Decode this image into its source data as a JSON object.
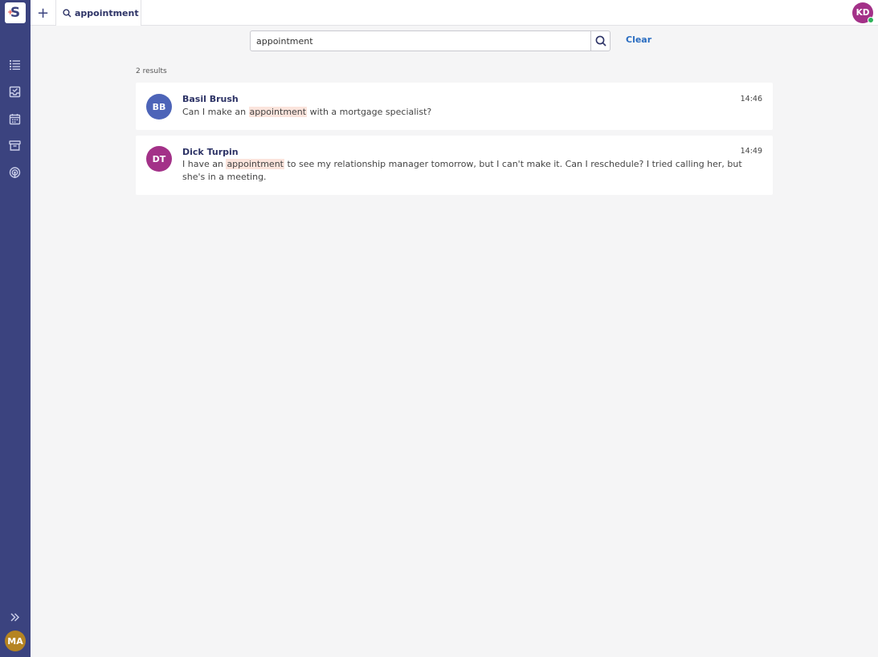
{
  "app": {
    "logo_text": "S",
    "current_user_initials": "MA"
  },
  "topbar": {
    "new_tab_label": "+",
    "tab": {
      "label": "appointment"
    },
    "agent_initials": "KD"
  },
  "search": {
    "value": "appointment",
    "clear_label": "Clear"
  },
  "results": {
    "count_label": "2 results",
    "items": [
      {
        "initials": "BB",
        "avatar_color": "#4d64b8",
        "name": "Basil Brush",
        "time": "14:46",
        "text_before": "Can I make an ",
        "highlight": "appointment",
        "text_after": " with a mortgage specialist?"
      },
      {
        "initials": "DT",
        "avatar_color": "#a33188",
        "name": "Dick Turpin",
        "time": "14:49",
        "text_before": "I have an ",
        "highlight": "appointment",
        "text_after": " to see my relationship manager tomorrow, but I can't make it. Can I reschedule? I tried calling her, but she's in a meeting."
      }
    ]
  },
  "colors": {
    "sidebar": "#3b437f",
    "accent_link": "#2a6dc1",
    "highlight": "#fbe4dc",
    "online": "#2fb35a"
  },
  "sidebar_icons": [
    "list-icon",
    "inbox-icon",
    "calendar-icon",
    "archive-icon",
    "broadcast-icon",
    "expand-icon"
  ]
}
